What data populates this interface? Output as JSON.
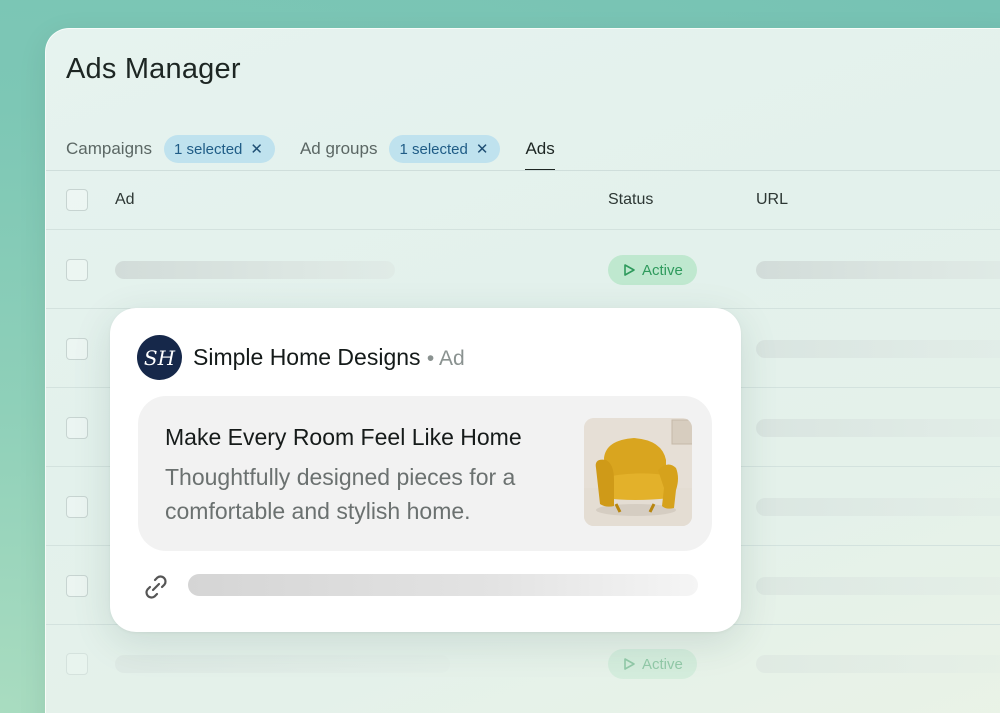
{
  "app": {
    "title": "Ads Manager"
  },
  "tabs": {
    "campaigns": {
      "label": "Campaigns",
      "chip": "1 selected"
    },
    "ad_groups": {
      "label": "Ad groups",
      "chip": "1 selected"
    },
    "ads": {
      "label": "Ads"
    }
  },
  "table": {
    "columns": {
      "ad": "Ad",
      "status": "Status",
      "url": "URL"
    },
    "rows": [
      {
        "status": "Active"
      },
      {
        "status": ""
      },
      {
        "status": ""
      },
      {
        "status": ""
      },
      {
        "status": ""
      },
      {
        "status": "Active"
      }
    ]
  },
  "ad_preview": {
    "logo_initials": "SH",
    "advertiser": "Simple Home Designs",
    "label": "• Ad",
    "headline": "Make Every Room Feel Like Home",
    "description": "Thoughtfully designed pieces for a comfortable and stylish home.",
    "image": "yellow-armchair"
  },
  "colors": {
    "chip_bg": "#bfe2ee",
    "chip_text": "#1f5c86",
    "status_bg": "#bfe8cf",
    "status_text": "#2e9a5c",
    "logo_bg": "#16284a"
  }
}
